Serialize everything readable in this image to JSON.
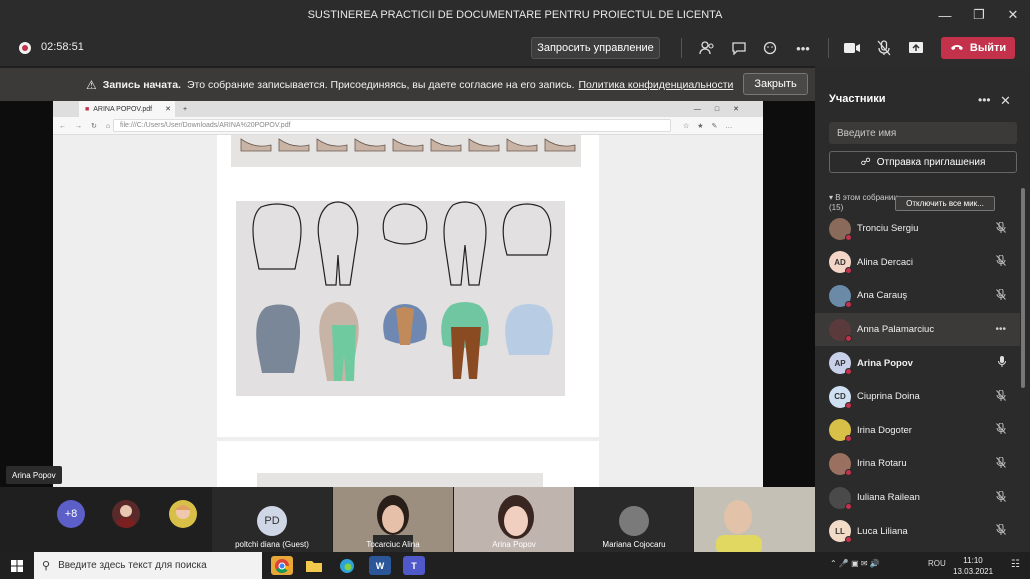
{
  "window": {
    "title": "SUSTINEREA PRACTICII DE DOCUMENTARE PENTRU PROIECTUL DE LICENTA"
  },
  "toolbar": {
    "timer": "02:58:51",
    "request_control": "Запросить управление",
    "leave": "Выйти"
  },
  "banner": {
    "bold": "Запись начата.",
    "text": "Это собрание записывается. Присоединяясь, вы даете согласие на его запись.",
    "link": "Политика конфиденциальности",
    "close": "Закрыть"
  },
  "browser": {
    "tab_title": "ARINA POPOV.pdf",
    "url": "file:///C:/Users/User/Downloads/ARINA%20POPOV.pdf"
  },
  "stage": {
    "presenter": "Arina Popov"
  },
  "participants": {
    "title": "Участники",
    "search_placeholder": "Введите имя",
    "invite": "Отправка приглашения",
    "in_meeting": "В этом собрании",
    "count": "(15)",
    "mute_all": "Отключить все мик...",
    "list": [
      {
        "name": "Tronciu Sergiu",
        "initials": "",
        "color": "#8a6a5a"
      },
      {
        "name": "Alina Dercaci",
        "initials": "AD",
        "color": "#f3d6c8"
      },
      {
        "name": "Ana Carauş",
        "initials": "",
        "color": "#6a8aa8"
      },
      {
        "name": "Anna Palamarciuc",
        "initials": "",
        "color": "#5a3a3a"
      },
      {
        "name": "Arina Popov",
        "initials": "AP",
        "color": "#c8d0ea"
      },
      {
        "name": "Ciuprina Doina",
        "initials": "CD",
        "color": "#cfe0f2"
      },
      {
        "name": "Irina Dogoter",
        "initials": "",
        "color": "#d8c048"
      },
      {
        "name": "Irina Rotaru",
        "initials": "",
        "color": "#9a7060"
      },
      {
        "name": "Iuliana Railean",
        "initials": "",
        "color": "#4a4a4a"
      },
      {
        "name": "Luca Liliana",
        "initials": "LL",
        "color": "#f2dcc8"
      }
    ]
  },
  "strip": {
    "more": "+8",
    "tiles": [
      {
        "name": "poltchi diana (Guest)",
        "initials": "PD"
      },
      {
        "name": "Tocarciuc Alina"
      },
      {
        "name": "Arina Popov"
      },
      {
        "name": "Mariana Cojocaru"
      }
    ]
  },
  "taskbar": {
    "search": "Введите здесь текст для поиска",
    "lang": "ROU",
    "time": "11:10",
    "date": "13.03.2021"
  }
}
